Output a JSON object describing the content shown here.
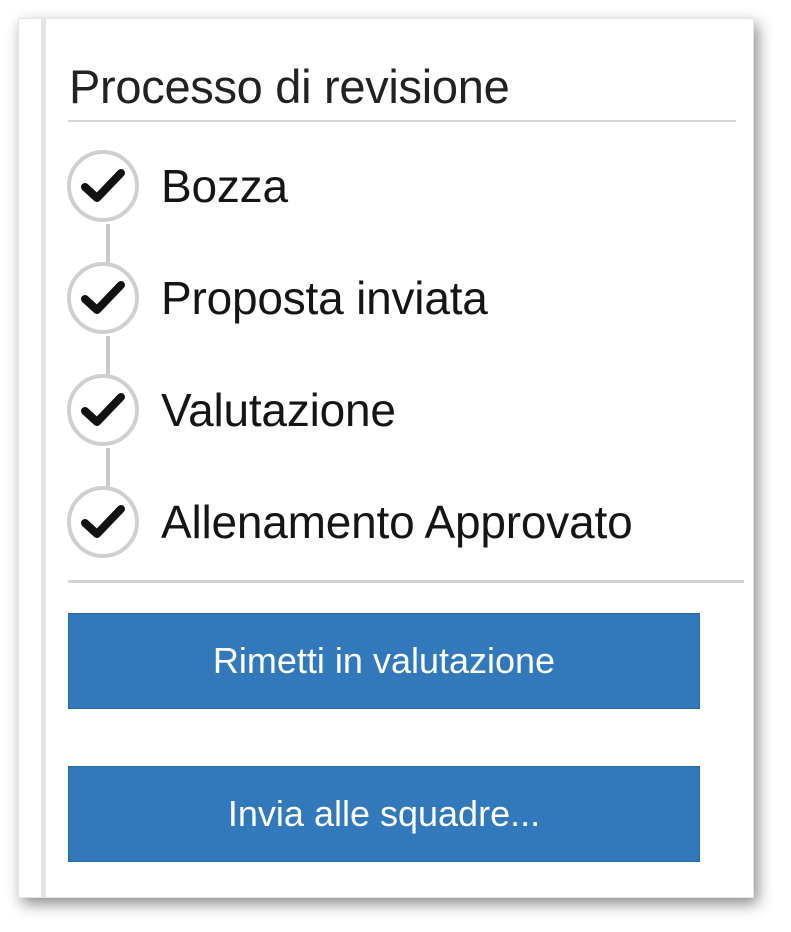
{
  "panel": {
    "title": "Processo di revisione"
  },
  "steps": [
    {
      "label": "Bozza",
      "icon": "check-icon",
      "completed": true
    },
    {
      "label": "Proposta inviata",
      "icon": "check-icon",
      "completed": true
    },
    {
      "label": "Valutazione",
      "icon": "check-icon",
      "completed": true
    },
    {
      "label": "Allenamento Approvato",
      "icon": "check-icon",
      "completed": true
    }
  ],
  "actions": {
    "reevaluate_label": "Rimetti in valutazione",
    "send_label": "Invia alle squadre..."
  },
  "colors": {
    "button": "#3179bb",
    "check": "#111111",
    "circle_border": "#cfcfcf"
  }
}
